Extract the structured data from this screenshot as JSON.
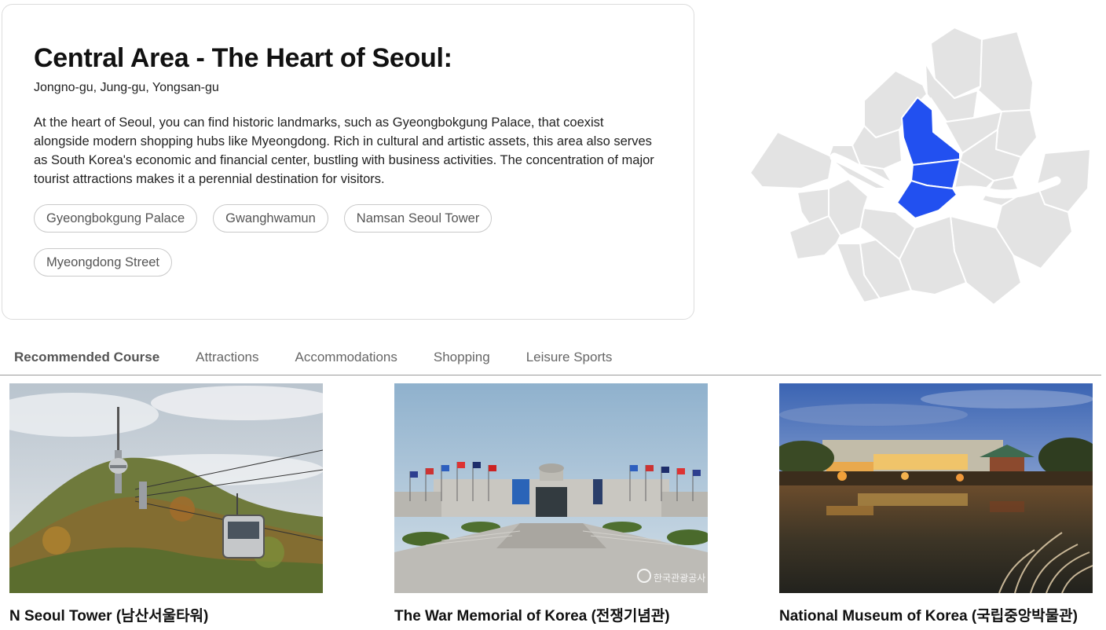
{
  "area": {
    "title": "Central Area - The Heart of Seoul:",
    "districts": "Jongno-gu, Jung-gu, Yongsan-gu",
    "description": "At the heart of Seoul, you can find historic landmarks, such as Gyeongbokgung Palace, that coexist alongside modern shopping hubs like Myeongdong. Rich in cultural and artistic assets, this area also serves as South Korea's economic and financial center, bustling with business activities. The concentration of major tourist attractions makes it a perennial destination for visitors.",
    "tags": [
      "Gyeongbokgung Palace",
      "Gwanghwamun",
      "Namsan Seoul Tower",
      "Myeongdong Street"
    ]
  },
  "map": {
    "highlight_color": "#2250f0",
    "district_color": "#e3e3e3",
    "river_color": "#ffffff"
  },
  "tabs": [
    {
      "label": "Recommended Course",
      "active": true
    },
    {
      "label": "Attractions",
      "active": false
    },
    {
      "label": "Accommodations",
      "active": false
    },
    {
      "label": "Shopping",
      "active": false
    },
    {
      "label": "Leisure Sports",
      "active": false
    }
  ],
  "cards": [
    {
      "title": "N Seoul Tower (남산서울타워)",
      "image": "n-seoul-tower-cable-car-photo"
    },
    {
      "title": "The War Memorial of Korea (전쟁기념관)",
      "image": "war-memorial-photo",
      "watermark": "한국관광공사"
    },
    {
      "title": "National Museum of Korea (국립중앙박물관)",
      "image": "national-museum-night-photo"
    }
  ]
}
